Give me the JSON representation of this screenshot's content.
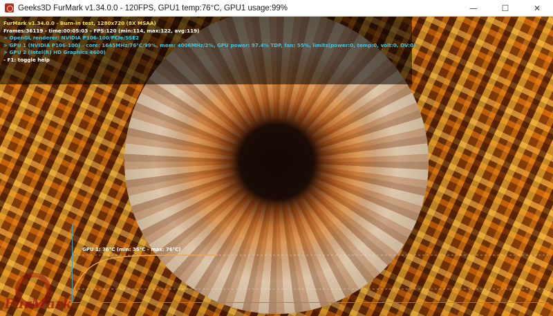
{
  "window": {
    "title": "Geeks3D FurMark v1.34.0.0 - 120FPS, GPU1 temp:76°C, GPU1 usage:99%",
    "controls": {
      "minimize": "—",
      "maximize": "☐",
      "close": "✕"
    }
  },
  "hud": {
    "lines": [
      {
        "text": "FurMark v1.34.0.0 - Burn-in test, 1280x720 (8X MSAA)",
        "color": "yellow"
      },
      {
        "text": "Frames:36119 - time:00:05:03 - FPS:120 (min:114, max:122, avg:119)",
        "color": "white"
      },
      {
        "text": "> OpenGL renderer: NVIDIA P106-100/PCIe/SSE2",
        "color": "cyan"
      },
      {
        "text": "> GPU 1 (NVIDIA P106-100) - core: 1645MHz/76°C/99%, mem: 4006MHz/2%, GPU power: 97.4% TDP, fan: 55%, limits(power:0, temp:0, volt:0, OV:0)",
        "color": "cyan"
      },
      {
        "text": "> GPU 2 (Intel(R) HD Graphics 4600)",
        "color": "cyan"
      },
      {
        "text": "- F1: toggle help",
        "color": "white"
      }
    ]
  },
  "temp_graph": {
    "label": "GPU 1: 76°C (min: 35°C - max: 76°C)",
    "current_c": 76,
    "min_c": 35,
    "max_c": 76,
    "line_color": "#f0a84a",
    "axis_color": "#3aa0c8"
  },
  "logo": {
    "text": "FurMark"
  }
}
